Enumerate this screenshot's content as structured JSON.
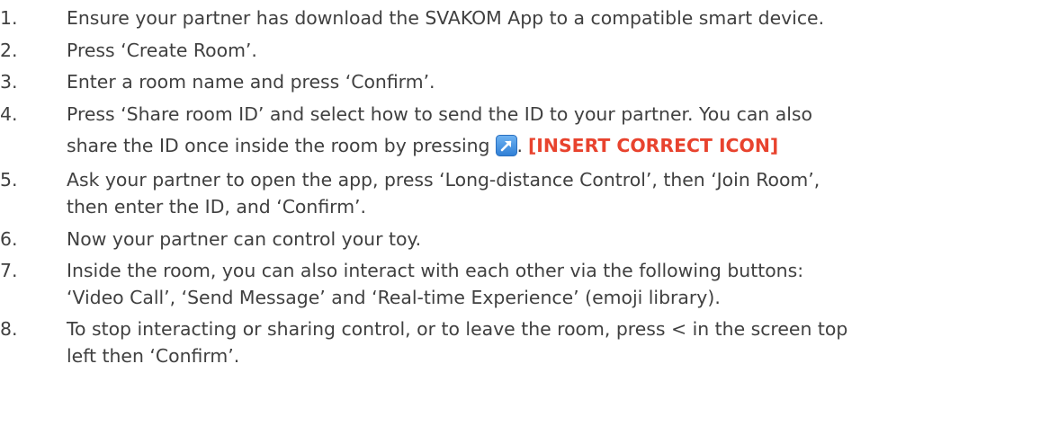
{
  "steps": [
    {
      "number": "1.",
      "lines": [
        "Ensure your partner has download the SVAKOM App to a compatible smart device."
      ]
    },
    {
      "number": "2.",
      "lines": [
        "Press ‘Create Room’."
      ]
    },
    {
      "number": "3.",
      "lines": [
        "Enter a room name and press ‘Confirm’."
      ]
    },
    {
      "number": "4.",
      "lines": [
        "Press ‘Share room ID’ and select how to send the ID to your partner. You can also"
      ],
      "tail_before_icon": "share the ID once inside the room by pressing",
      "tail_after_icon": ".",
      "icon": "share-arrow-icon",
      "icon_color": "#3a8ee0",
      "alert": "[INSERT CORRECT ICON]",
      "alert_color": "#e8432e"
    },
    {
      "number": "5.",
      "lines": [
        "Ask your partner to open the app, press ‘Long-distance Control’, then ‘Join Room’,",
        "then enter the ID, and ‘Confirm’."
      ]
    },
    {
      "number": "6.",
      "lines": [
        "Now your partner can control your toy."
      ]
    },
    {
      "number": "7.",
      "lines": [
        "Inside the room, you can also interact with each other via the following buttons:",
        "‘Video Call’, ‘Send Message’ and ‘Real-time Experience’ (emoji library)."
      ]
    },
    {
      "number": "8.",
      "lines": [
        "To stop interacting or sharing control, or to leave the room, press < in the screen top",
        "left then ‘Confirm’."
      ]
    }
  ]
}
